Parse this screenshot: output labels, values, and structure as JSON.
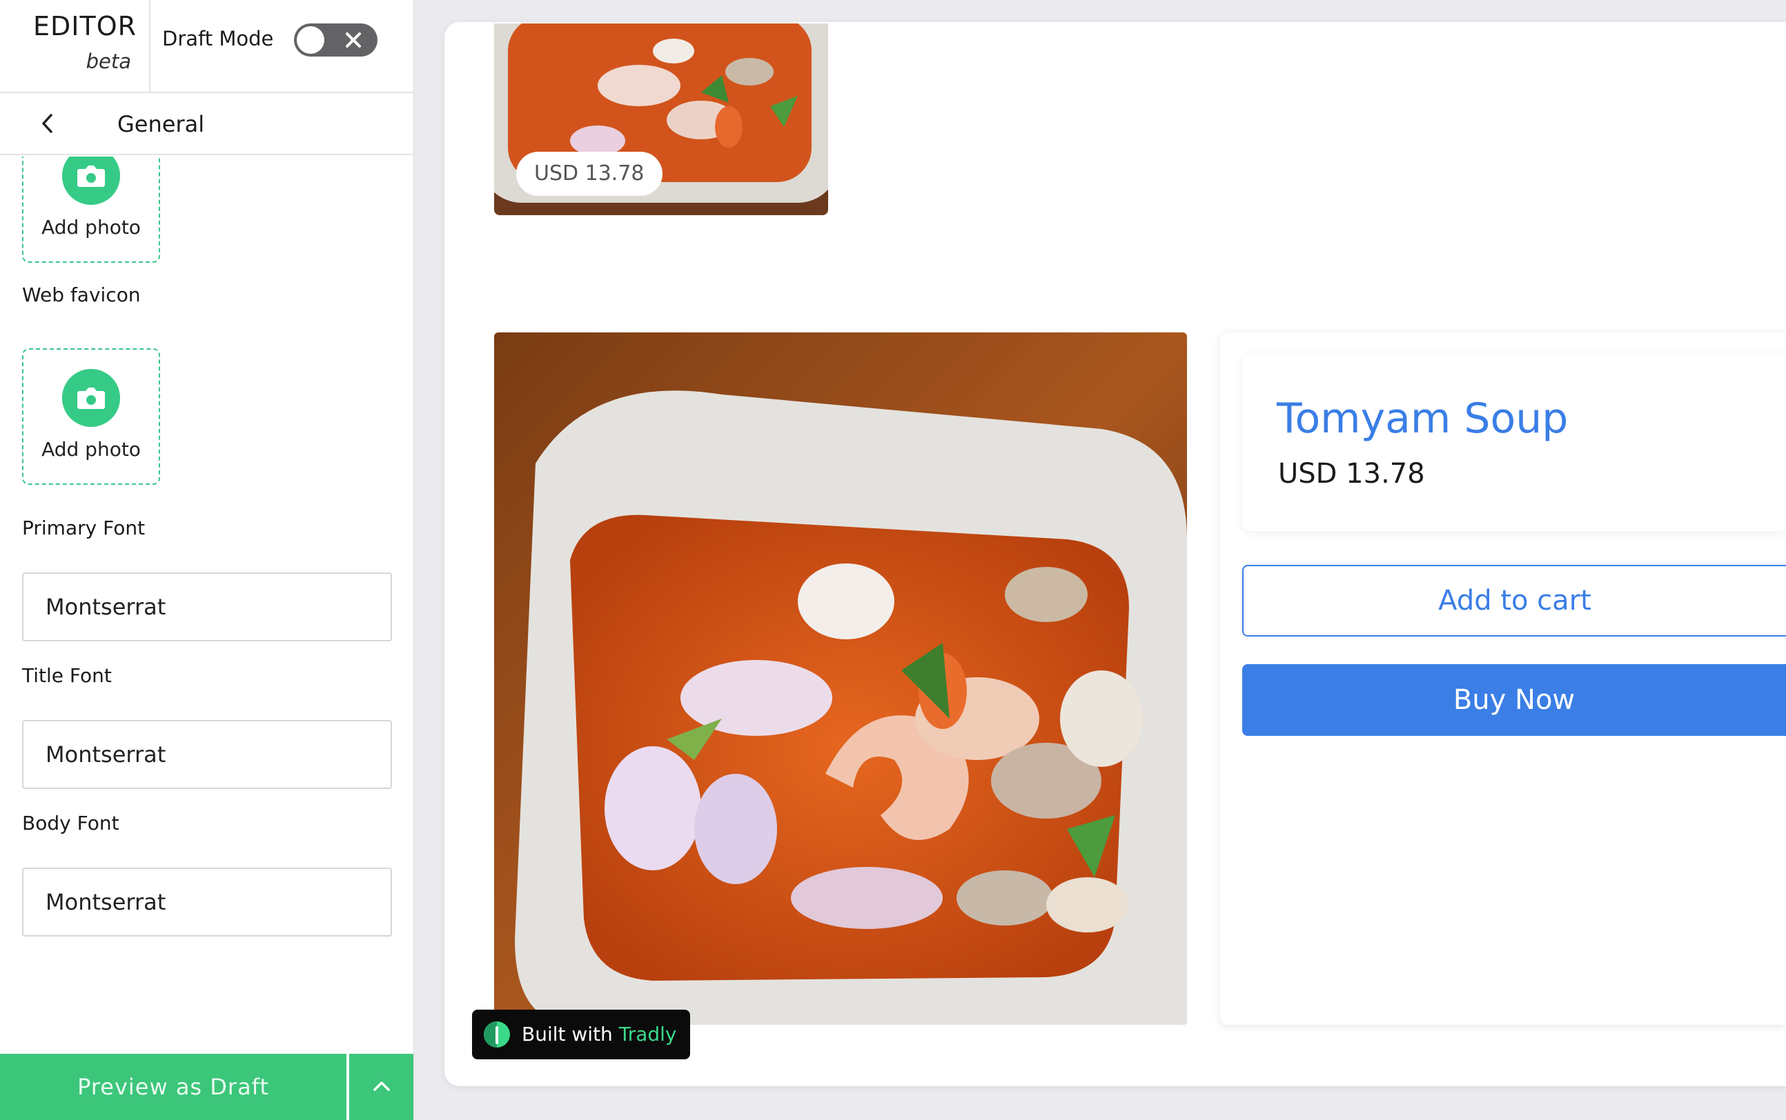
{
  "editor": {
    "title": "EDITOR",
    "subtitle": "beta",
    "draft_mode_label": "Draft Mode",
    "draft_mode_on": false
  },
  "section": {
    "title": "General"
  },
  "uploads": [
    {
      "label": "Add photo"
    },
    {
      "field_label": "Web favicon",
      "label": "Add photo"
    }
  ],
  "fonts": [
    {
      "label": "Primary Font",
      "value": "Montserrat"
    },
    {
      "label": "Title Font",
      "value": "Montserrat"
    },
    {
      "label": "Body Font",
      "value": "Montserrat"
    }
  ],
  "footer": {
    "preview_label": "Preview as Draft"
  },
  "preview": {
    "thumb_price": "USD 13.78",
    "product_title": "Tomyam Soup",
    "product_price": "USD 13.78",
    "add_to_cart_label": "Add to cart",
    "buy_now_label": "Buy Now",
    "built_with_prefix": "Built with",
    "built_with_brand": "Tradly"
  },
  "colors": {
    "accent_green": "#3bc67a",
    "primary_blue": "#3a7ee6",
    "toggle_off": "#636366"
  },
  "icons": [
    "close-icon",
    "chevron-left-icon",
    "camera-icon",
    "chevron-up-icon",
    "tradly-logo-icon"
  ]
}
